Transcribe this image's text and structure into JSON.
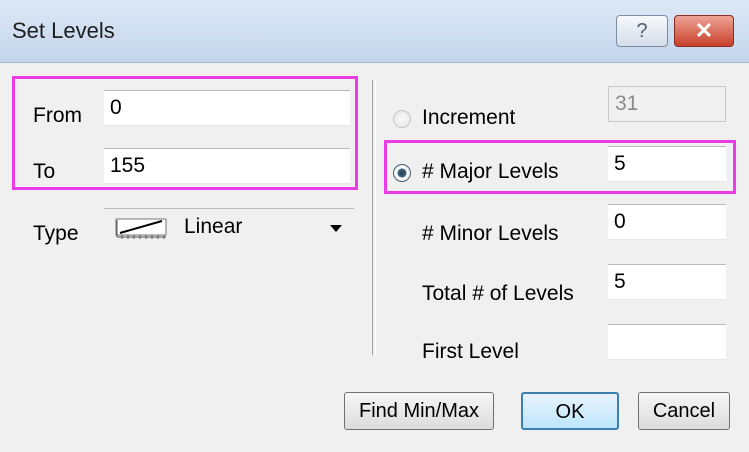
{
  "dialog": {
    "title": "Set Levels",
    "help_label": "?",
    "close_label": "✕"
  },
  "range": {
    "from_label": "From",
    "from_value": "0",
    "to_label": "To",
    "to_value": "155"
  },
  "type": {
    "label": "Type",
    "value": "Linear",
    "icon": "linear-scale-icon"
  },
  "increment": {
    "label": "Increment",
    "value": "31",
    "selected": false
  },
  "major_levels": {
    "label": "# Major Levels",
    "value": "5",
    "selected": true
  },
  "minor_levels": {
    "label": "# Minor Levels",
    "value": "0"
  },
  "total_levels": {
    "label": "Total # of Levels",
    "value": "5"
  },
  "first_level": {
    "label": "First Level",
    "value": ""
  },
  "buttons": {
    "find_minmax": "Find Min/Max",
    "ok": "OK",
    "cancel": "Cancel"
  },
  "colors": {
    "highlight": "#ea3ce6",
    "default_button": "#3c7fb1"
  }
}
